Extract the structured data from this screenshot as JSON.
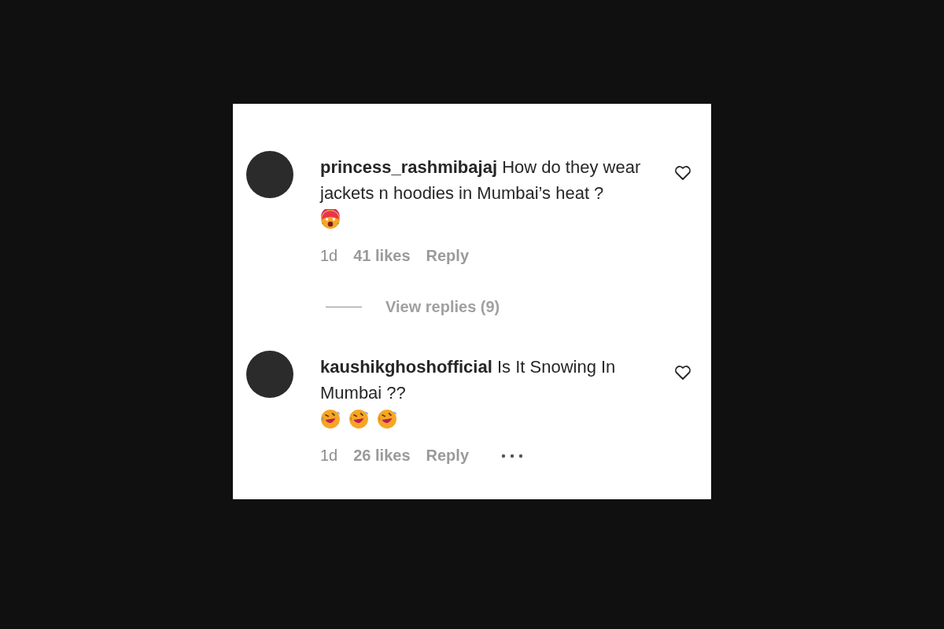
{
  "comments": [
    {
      "text": "**princess_rashmibajaj** How do they wear jackets n hoodies in Mumbai’s heat ?",
      "emojis": [
        {
          "kind": "hot-face"
        }
      ],
      "time": "1d",
      "likes": "41 likes",
      "reply": "Reply",
      "view_replies": "View replies (9)",
      "more": false
    },
    {
      "text": "**kaushikghoshofficial** Is It Snowing In Mumbai ??",
      "emojis": [
        {
          "kind": "laughing-face"
        },
        {
          "kind": "laughing-face"
        },
        {
          "kind": "laughing-face"
        }
      ],
      "time": "1d",
      "likes": "26 likes",
      "reply": "Reply",
      "more": true
    }
  ]
}
